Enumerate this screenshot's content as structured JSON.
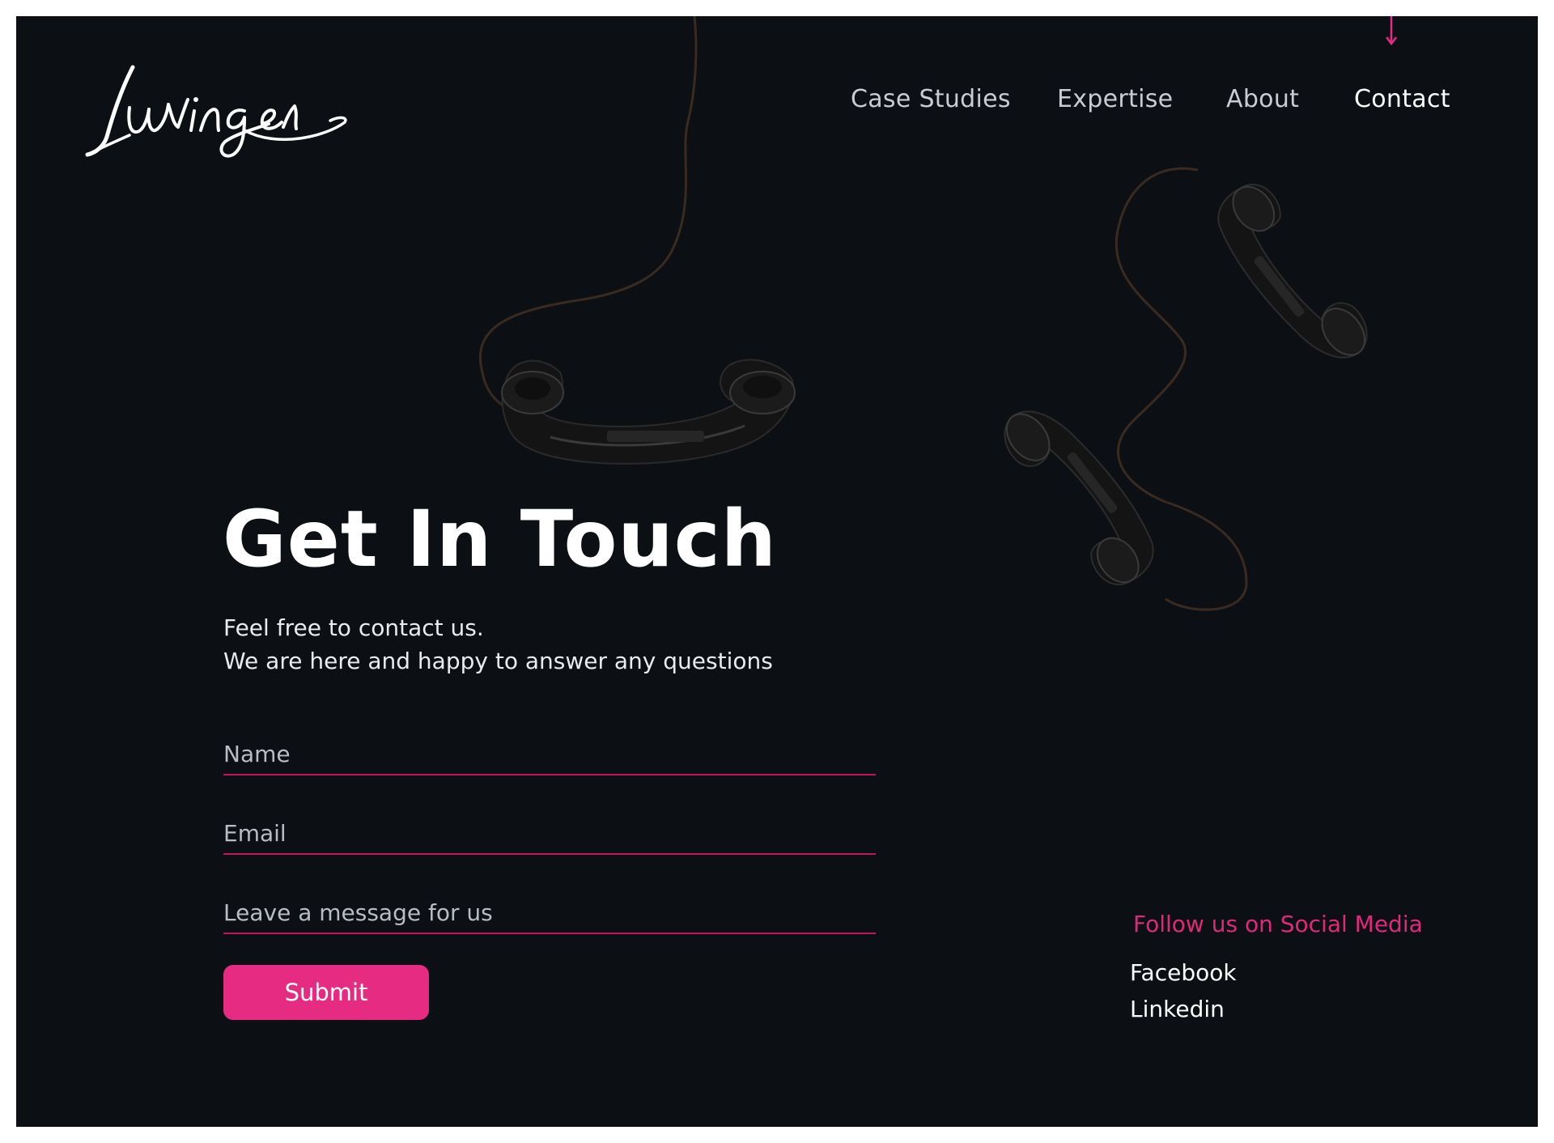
{
  "brand": {
    "logo_text": "Luvinger"
  },
  "nav": {
    "items": [
      {
        "label": "Case Studies"
      },
      {
        "label": "Expertise"
      },
      {
        "label": "About"
      },
      {
        "label": "Contact"
      }
    ],
    "active": "Contact"
  },
  "hero": {
    "title": "Get In Touch",
    "subtitle_line1": "Feel free to contact us.",
    "subtitle_line2": "We are here and happy to answer any questions"
  },
  "form": {
    "name_placeholder": "Name",
    "email_placeholder": "Email",
    "message_placeholder": "Leave a message for us",
    "submit_label": "Submit"
  },
  "social": {
    "title": "Follow us on Social Media",
    "links": [
      {
        "label": "Facebook"
      },
      {
        "label": "Linkedin"
      }
    ]
  },
  "colors": {
    "background": "#0c1015",
    "accent": "#e62b82",
    "text": "#ffffff",
    "muted_text": "#c9ccd2"
  },
  "icons": [
    "telephone-handset-icon",
    "nav-indicator-arrow-icon"
  ]
}
